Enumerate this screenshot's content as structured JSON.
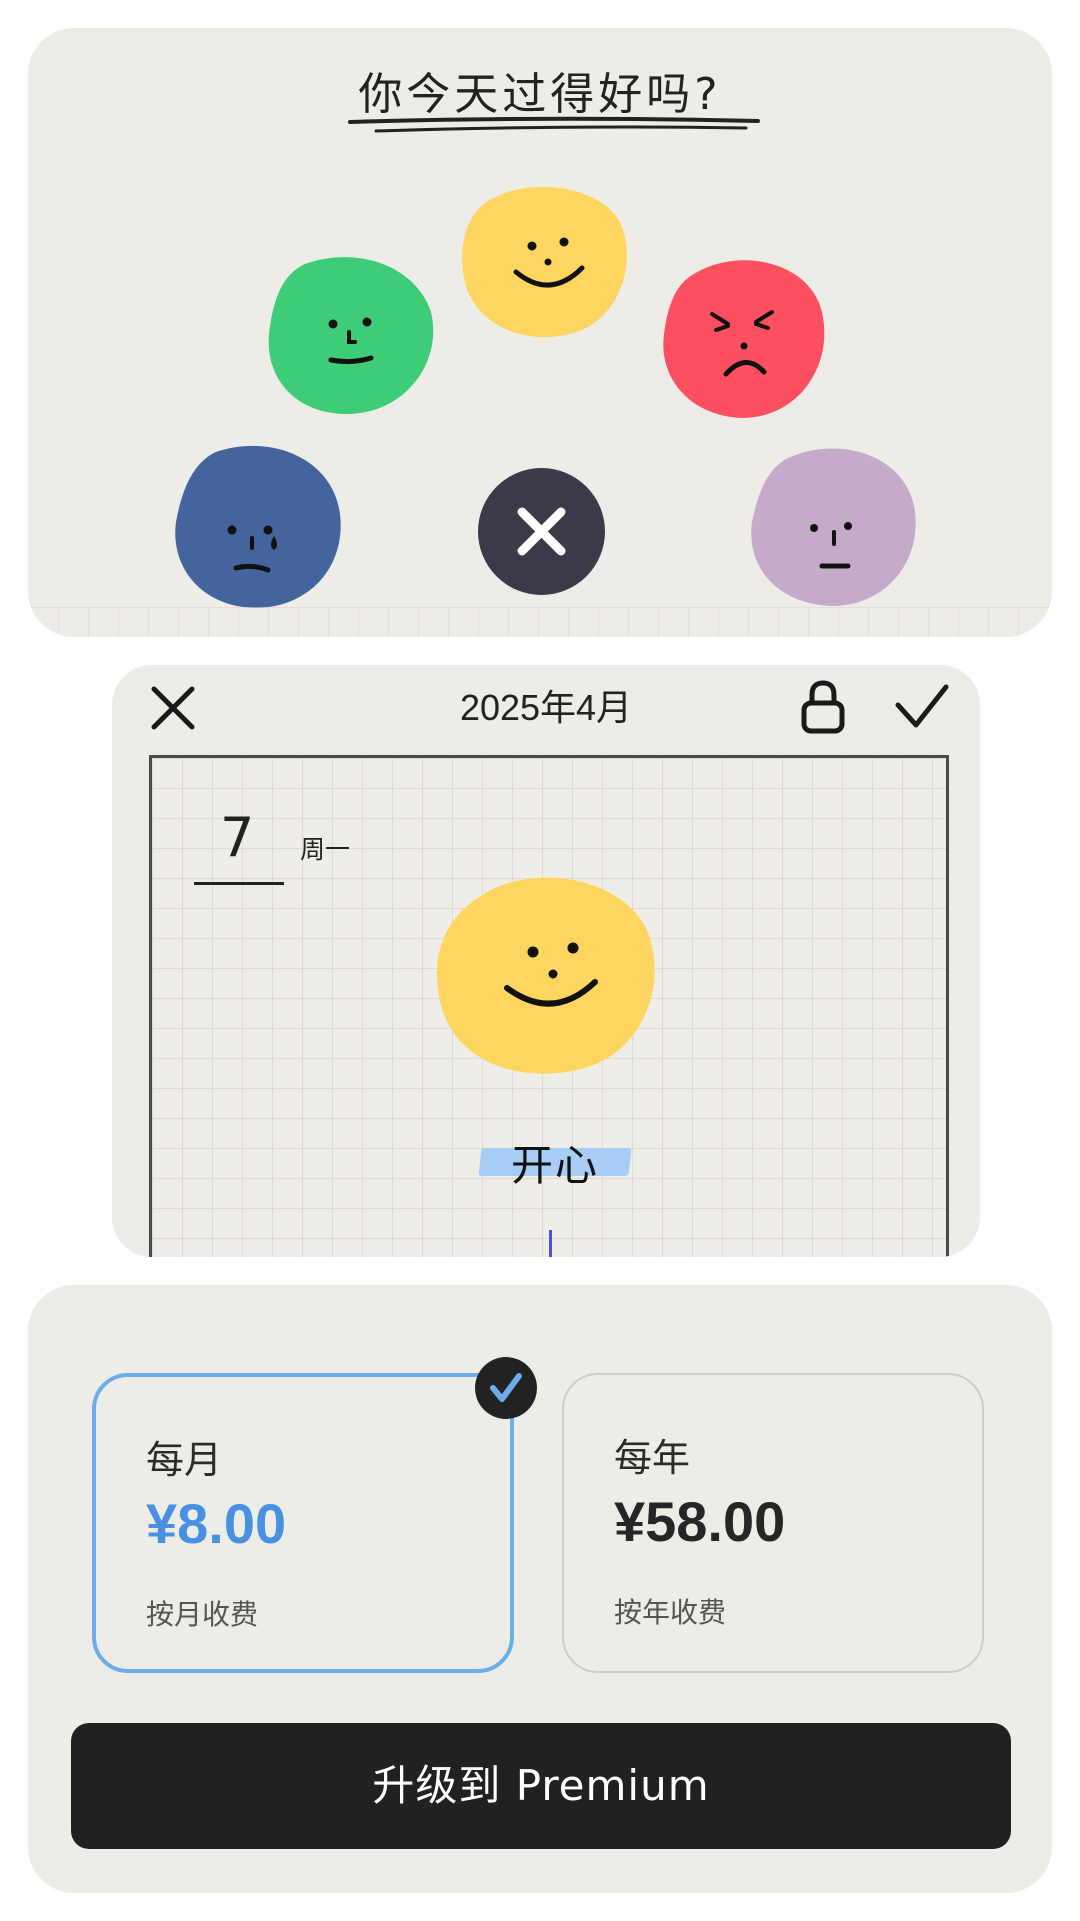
{
  "mood_picker": {
    "title": "你今天过得好吗?",
    "moods": [
      {
        "id": "happy",
        "color": "#fdd55f"
      },
      {
        "id": "calm",
        "color": "#3ecc76"
      },
      {
        "id": "angry",
        "color": "#fc4f5f"
      },
      {
        "id": "sad",
        "color": "#44649d"
      },
      {
        "id": "meh",
        "color": "#c5aaca"
      }
    ],
    "close_icon": "close-icon",
    "close_color": "#3a3a48"
  },
  "entry": {
    "date_title": "2025年4月",
    "day": "7",
    "weekday": "周一",
    "mood_label": "开心",
    "mood_color": "#fdd55f",
    "highlight_color": "#a8cdf5",
    "icons": [
      "close-icon",
      "lock-icon",
      "check-icon"
    ]
  },
  "subscription": {
    "plans": [
      {
        "name": "每月",
        "price": "¥8.00",
        "note": "按月收费",
        "selected": true
      },
      {
        "name": "每年",
        "price": "¥58.00",
        "note": "按年收费",
        "selected": false
      }
    ],
    "selected_color": "#4a90e2",
    "upgrade_label": "升级到 Premium"
  }
}
